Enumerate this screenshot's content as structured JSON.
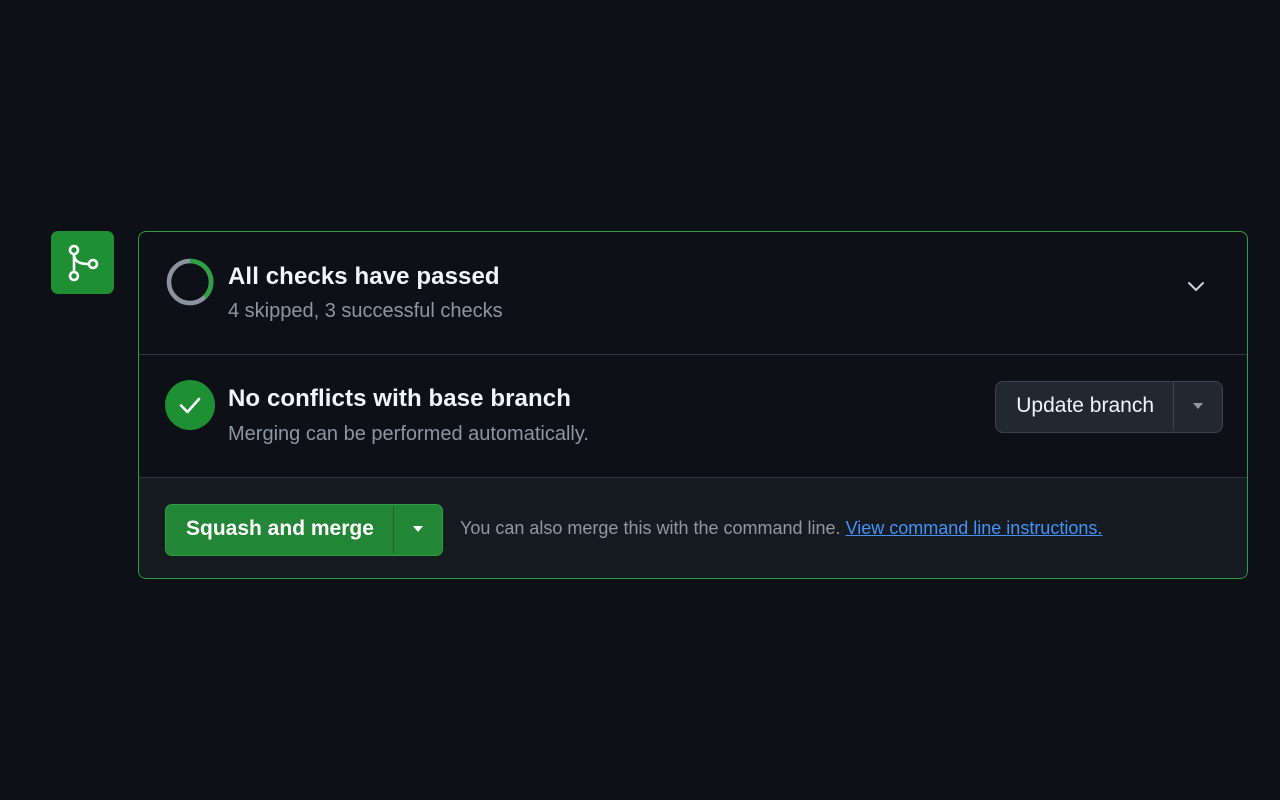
{
  "icons": {
    "merge_tile": "git-merge-icon",
    "checks_status": "progress-ring-icon",
    "conflicts_status": "check-circle-icon",
    "expand": "chevron-down-icon",
    "caret": "triangle-down-icon"
  },
  "colors": {
    "background": "#0d1117",
    "accent_green": "#238636",
    "border_green": "#2ea043",
    "link_blue": "#4493f8"
  },
  "checks": {
    "title": "All checks have passed",
    "subtitle": "4 skipped, 3 successful checks"
  },
  "conflicts": {
    "title": "No conflicts with base branch",
    "subtitle": "Merging can be performed automatically.",
    "update_button_label": "Update branch"
  },
  "merge": {
    "button_label": "Squash and merge",
    "hint_text": "You can also merge this with the command line.",
    "link_text": "View command line instructions."
  }
}
